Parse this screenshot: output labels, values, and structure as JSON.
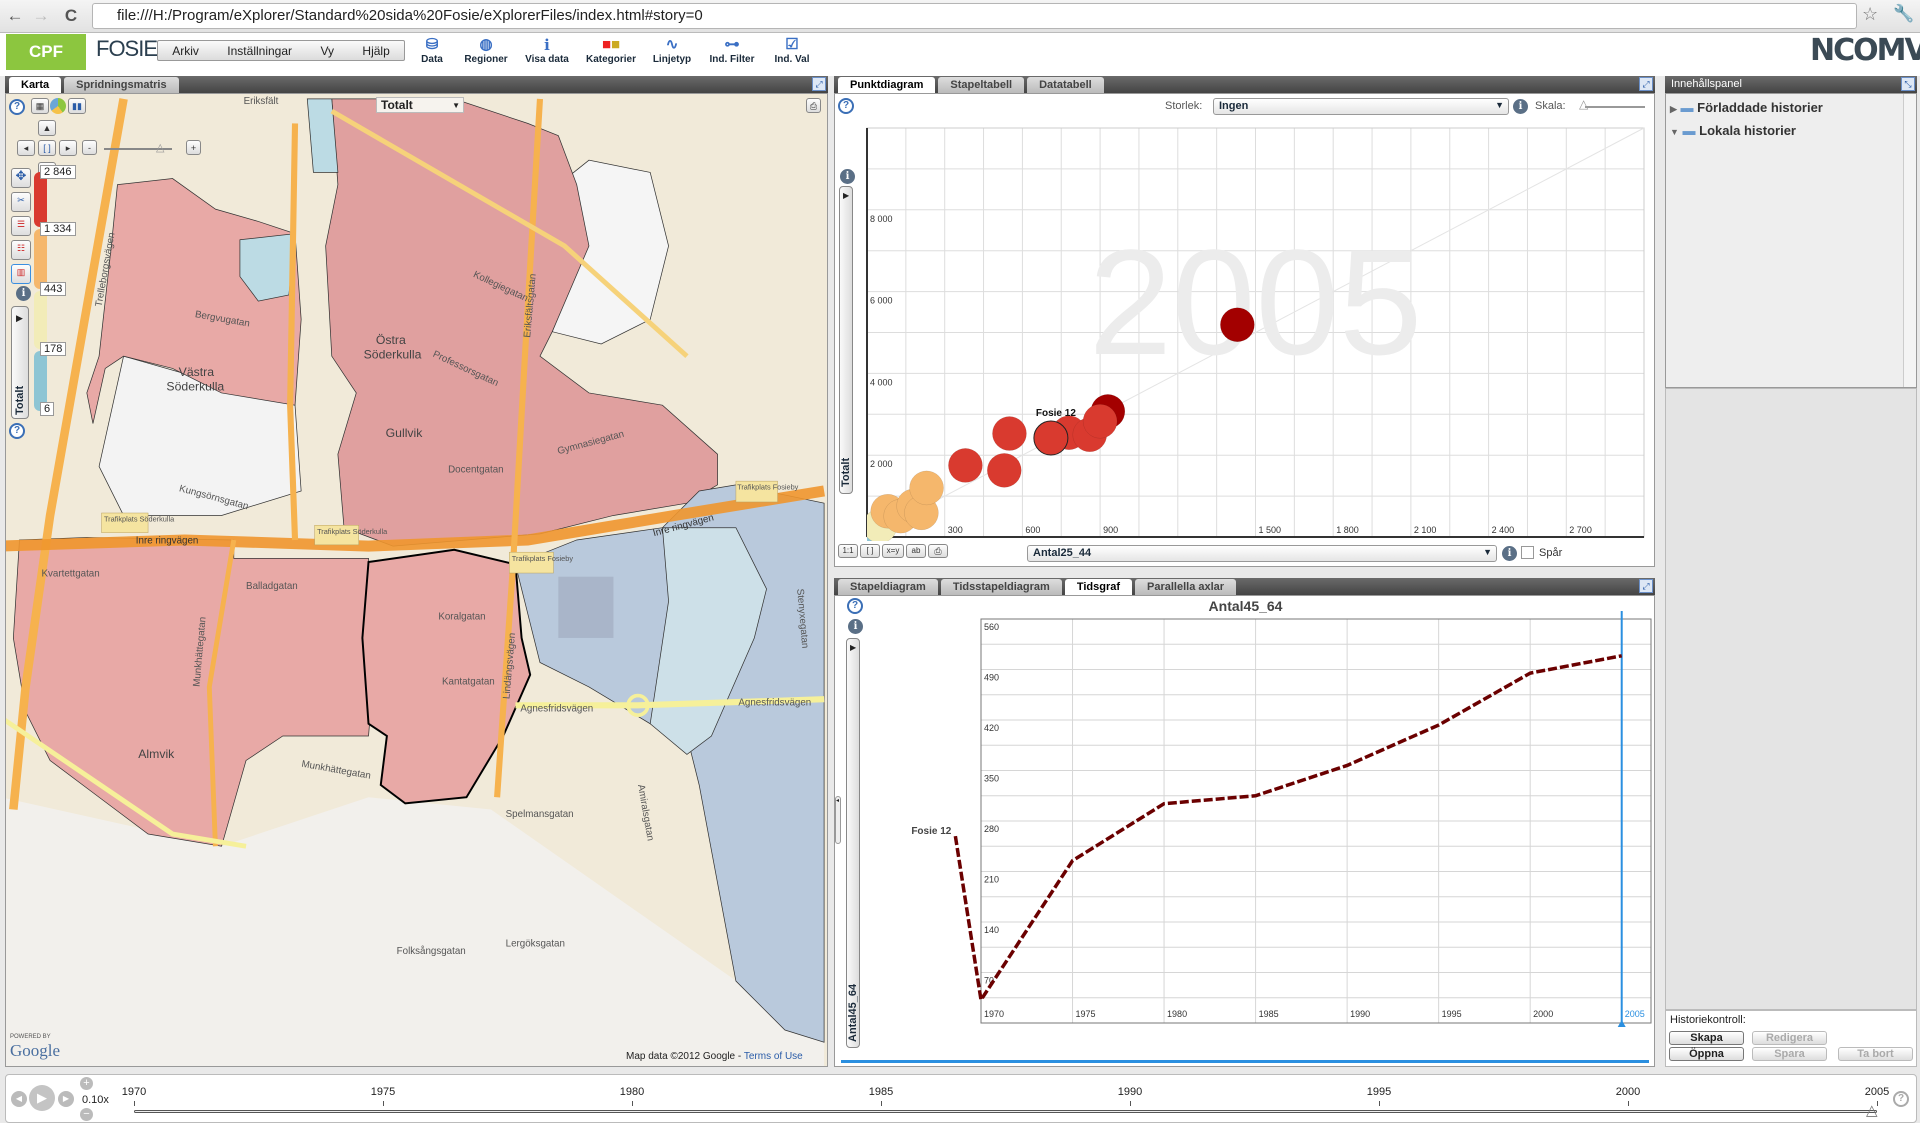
{
  "browser": {
    "url": "file:///H:/Program/eXplorer/Standard%20sida%20Fosie/eXplorerFiles/index.html#story=0",
    "back": "←",
    "forward": "→",
    "reload": "C"
  },
  "app": {
    "logo": "CPF",
    "title": "FOSIE",
    "brand": "NCOMVA",
    "menu": [
      "Arkiv",
      "Inställningar",
      "Vy",
      "Hjälp"
    ],
    "tools": [
      {
        "label": "Data",
        "icon": "database-icon"
      },
      {
        "label": "Regioner",
        "icon": "globe-icon"
      },
      {
        "label": "Visa data",
        "icon": "info-icon"
      },
      {
        "label": "Kategorier",
        "icon": "categories-icon"
      },
      {
        "label": "Linjetyp",
        "icon": "line-type-icon"
      },
      {
        "label": "Ind. Filter",
        "icon": "filter-icon"
      },
      {
        "label": "Ind. Val",
        "icon": "checkmark-icon"
      }
    ]
  },
  "map_panel": {
    "tabs": [
      "Karta",
      "Spridningsmatris"
    ],
    "active_tab": "Karta",
    "indicator": "Totalt",
    "vertical_label": "Totalt",
    "legend": {
      "values": [
        "2 846",
        "1 334",
        "443",
        "178",
        "6"
      ],
      "colors": [
        "#d93a2f",
        "#f5b76c",
        "#f2ecb8",
        "#8ec5d4"
      ]
    },
    "labels": [
      "Eriksfält",
      "Kollegiegatan",
      "Professorsgatan",
      "Östra",
      "Söderkulla",
      "Västra",
      "Söderkulla",
      "Gullvik",
      "Docentgatan",
      "Gymnasiegatan",
      "Kungsörnsgatan",
      "Inre ringvägen",
      "Inre ringvägen",
      "Kvartettgatan",
      "Balladgatan",
      "Koralgatan",
      "Kantatgatan",
      "Agnesfridsvägen",
      "Agnesfridsvägen",
      "Almvik",
      "Munkhättegatan",
      "Spelmansgatan",
      "Folksångsgatan",
      "Lergöksgatan",
      "Trelleborgsvägen",
      "Bergvugatan",
      "Eriksfältsgatan",
      "Lindängsvägen",
      "Trafikplats Söderkulla",
      "Trafikplats Söderkulla",
      "Trafikplats Fosieby",
      "Trafikplats Fosieby",
      "Amiralsgatan",
      "Stenyxegatan",
      "Munkhättegatan"
    ],
    "attribution": "Map data ©2012 Google -",
    "terms": "Terms of Use",
    "powered": "POWERED BY",
    "google": "Google"
  },
  "scatter_panel": {
    "tabs": [
      "Punktdiagram",
      "Stapeltabell",
      "Datatabell"
    ],
    "active_tab": "Punktdiagram",
    "size_label": "Storlek:",
    "size_value": "Ingen",
    "scale_label": "Skala:",
    "x_select": "Antal25_44",
    "trail_label": "Spår",
    "year": "2005",
    "highlight": "Fosie 12",
    "y_label": "Totalt",
    "tools": [
      "1:1",
      "[ ]",
      "x=y",
      "ab",
      "⎙"
    ]
  },
  "time_panel": {
    "tabs": [
      "Stapeldiagram",
      "Tidsstapeldiagram",
      "Tidsgraf",
      "Parallella axlar"
    ],
    "active_tab": "Tidsgraf",
    "title": "Antal45_64",
    "y_label": "Antal45_64",
    "series_label": "Fosie 12",
    "current_year": "2005"
  },
  "content_panel": {
    "title": "Innehållspanel",
    "folders": [
      {
        "label": "Förladdade historier",
        "expanded": false
      },
      {
        "label": "Lokala historier",
        "expanded": true
      }
    ],
    "history_label": "Historiekontroll:",
    "buttons": [
      {
        "label": "Skapa",
        "enabled": true
      },
      {
        "label": "Redigera",
        "enabled": false
      },
      {
        "label": "Öppna",
        "enabled": true
      },
      {
        "label": "Spara",
        "enabled": false
      },
      {
        "label": "Ta bort",
        "enabled": false
      }
    ]
  },
  "timeline": {
    "speed": "0.10x",
    "ticks": [
      "1970",
      "1975",
      "1980",
      "1985",
      "1990",
      "1995",
      "2000",
      "2005"
    ],
    "current": "2005"
  },
  "chart_data": [
    {
      "type": "scatter",
      "xlabel": "Antal25_44",
      "ylabel": "Totalt",
      "xlim": [
        0,
        3000
      ],
      "ylim": [
        0,
        10000
      ],
      "grid": true,
      "x_ticks": [
        "300",
        "600",
        "900",
        "1 500",
        "1 800",
        "2 100",
        "2 400",
        "2 700"
      ],
      "x_tick_values": [
        300,
        600,
        900,
        1500,
        1800,
        2100,
        2400,
        2700
      ],
      "y_ticks": [
        "2 000",
        "4 000",
        "6 000",
        "8 000"
      ],
      "y_tick_values": [
        2000,
        4000,
        6000,
        8000
      ],
      "points": [
        {
          "x": 10,
          "y": 0,
          "color": "#8ec5d4"
        },
        {
          "x": 50,
          "y": 270,
          "color": "#f2ecb8"
        },
        {
          "x": 80,
          "y": 630,
          "color": "#f5b76c"
        },
        {
          "x": 130,
          "y": 510,
          "color": "#f5b76c"
        },
        {
          "x": 180,
          "y": 760,
          "color": "#f5b76c"
        },
        {
          "x": 210,
          "y": 590,
          "color": "#f5b76c"
        },
        {
          "x": 230,
          "y": 1200,
          "color": "#f5b76c"
        },
        {
          "x": 380,
          "y": 1750,
          "color": "#d93a2f"
        },
        {
          "x": 530,
          "y": 1630,
          "color": "#d93a2f"
        },
        {
          "x": 550,
          "y": 2530,
          "color": "#d93a2f"
        },
        {
          "x": 780,
          "y": 2550,
          "color": "#d93a2f"
        },
        {
          "x": 860,
          "y": 2500,
          "color": "#d93a2f"
        },
        {
          "x": 930,
          "y": 3070,
          "color": "#a30000"
        },
        {
          "x": 900,
          "y": 2830,
          "color": "#d93a2f"
        },
        {
          "x": 710,
          "y": 2420,
          "color": "#d93a2f",
          "label": "Fosie 12"
        },
        {
          "x": 1430,
          "y": 5190,
          "color": "#a30000"
        }
      ]
    },
    {
      "type": "line",
      "title": "Antal45_64",
      "ylabel": "Antal45_64",
      "xlim": [
        1970,
        2006.6
      ],
      "ylim": [
        0,
        560
      ],
      "grid": true,
      "x_ticks": [
        "1970",
        "1975",
        "1980",
        "1985",
        "1990",
        "1995",
        "2000",
        "2005"
      ],
      "x_tick_values": [
        1970,
        1975,
        1980,
        1985,
        1990,
        1995,
        2000,
        2005
      ],
      "y_ticks": [
        "560",
        "490",
        "420",
        "350",
        "280",
        "210",
        "140",
        "70"
      ],
      "y_tick_values": [
        560,
        490,
        420,
        350,
        280,
        210,
        140,
        70
      ],
      "series": [
        {
          "name": "Fosie 12",
          "color": "#6b0000",
          "x": [
            1968.6,
            1970,
            1975,
            1980,
            1985,
            1990,
            1995,
            2000,
            2005
          ],
          "y": [
            259,
            32,
            225,
            304,
            315,
            357,
            413,
            485,
            509
          ]
        }
      ]
    }
  ]
}
